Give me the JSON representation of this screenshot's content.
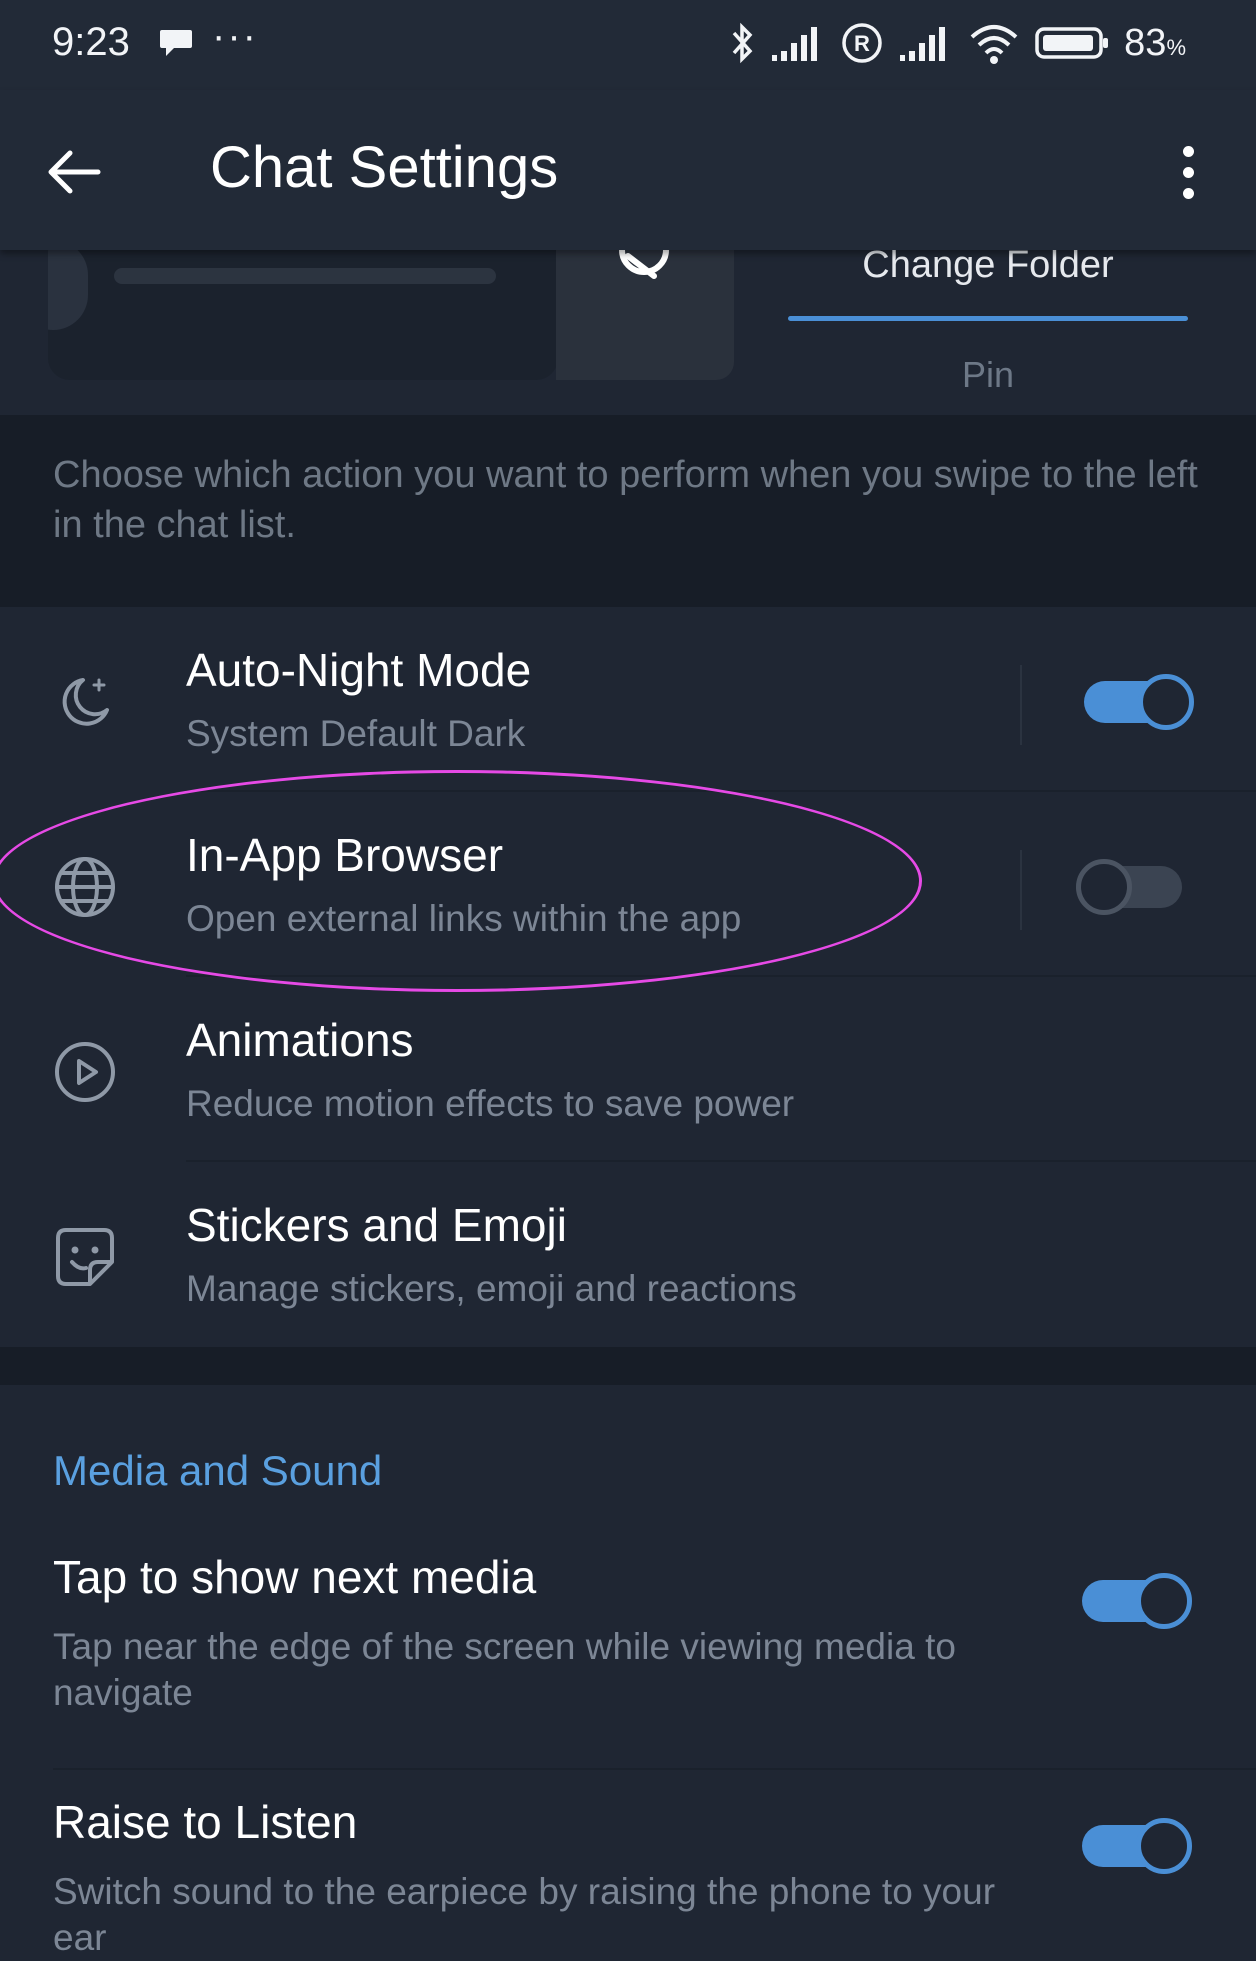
{
  "status_bar": {
    "time": "9:23",
    "more": "···",
    "battery_value": "83",
    "battery_unit": "%"
  },
  "app_bar": {
    "title": "Chat Settings"
  },
  "swipe_preview": {
    "change_folder_label": "Change Folder",
    "pin_label": "Pin"
  },
  "swipe_info": "Choose which action you want to perform when you swipe to the left in the chat list.",
  "settings_list": [
    {
      "title": "Auto-Night Mode",
      "subtitle": "System Default Dark",
      "icon": "moon-icon",
      "toggle": true
    },
    {
      "title": "In-App Browser",
      "subtitle": "Open external links within the app",
      "icon": "globe-icon",
      "toggle": false
    },
    {
      "title": "Animations",
      "subtitle": "Reduce motion effects to save power",
      "icon": "play-circle-icon"
    },
    {
      "title": "Stickers and Emoji",
      "subtitle": "Manage stickers, emoji and reactions",
      "icon": "sticker-icon"
    }
  ],
  "media_sound": {
    "header": "Media and Sound",
    "items": [
      {
        "title": "Tap to show next media",
        "subtitle": "Tap near the edge of the screen while viewing media to navigate",
        "toggle": true
      },
      {
        "title": "Raise to Listen",
        "subtitle": "Switch sound to the earpiece by raising the phone to your ear",
        "toggle": true
      }
    ]
  },
  "colors": {
    "background": "#1f2633",
    "accent": "#4a8fd6",
    "highlight": "#e64ae6"
  }
}
